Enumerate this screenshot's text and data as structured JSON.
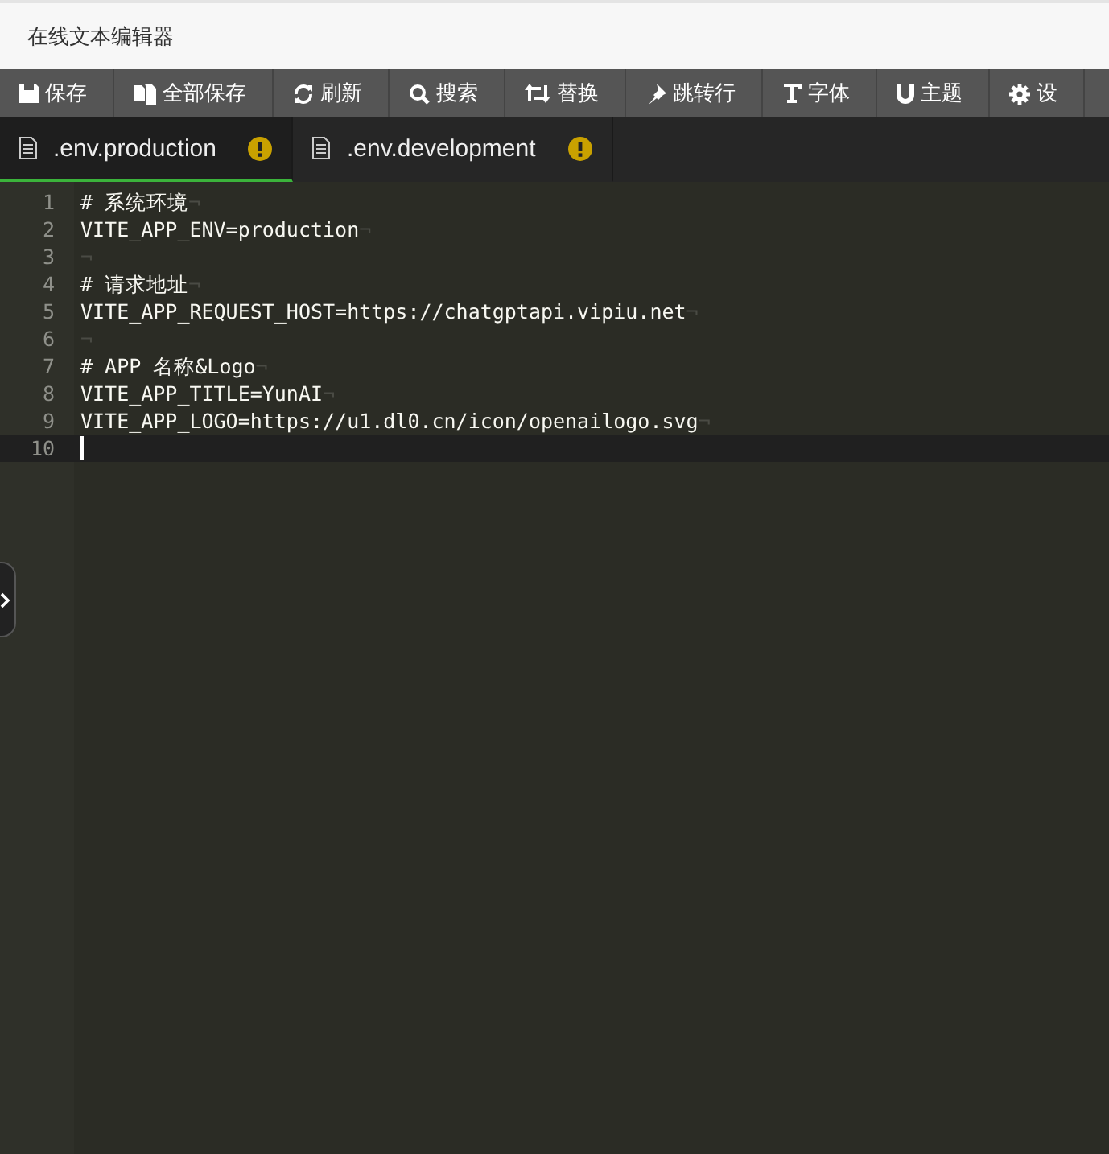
{
  "window": {
    "title": "在线文本编辑器"
  },
  "toolbar": [
    {
      "kind": "save",
      "label": "保存"
    },
    {
      "kind": "save-all",
      "label": "全部保存"
    },
    {
      "kind": "refresh",
      "label": "刷新"
    },
    {
      "kind": "search",
      "label": "搜索"
    },
    {
      "kind": "replace",
      "label": "替换"
    },
    {
      "kind": "goto",
      "label": "跳转行"
    },
    {
      "kind": "font",
      "label": "字体"
    },
    {
      "kind": "theme",
      "label": "主题"
    },
    {
      "kind": "settings",
      "label": "设"
    }
  ],
  "tabs": [
    {
      "label": ".env.production",
      "selected": true,
      "warning": true
    },
    {
      "label": ".env.development",
      "selected": false,
      "warning": true
    }
  ],
  "editor": {
    "lines": [
      {
        "number": "1",
        "text": "# 系统环境",
        "eol": "¬",
        "active": false
      },
      {
        "number": "2",
        "text": "VITE_APP_ENV=production",
        "eol": "¬",
        "active": false
      },
      {
        "number": "3",
        "eol": "¬",
        "active": false
      },
      {
        "number": "4",
        "text": "# 请求地址",
        "eol": "¬",
        "active": false
      },
      {
        "number": "5",
        "text": "VITE_APP_REQUEST_HOST=https://chatgptapi.vipiu.net",
        "eol": "¬",
        "active": false
      },
      {
        "number": "6",
        "eol": "¬",
        "active": false
      },
      {
        "number": "7",
        "text": "# APP 名称&Logo",
        "eol": "¬",
        "active": false
      },
      {
        "number": "8",
        "text": "VITE_APP_TITLE=YunAI",
        "eol": "¬",
        "active": false
      },
      {
        "number": "9",
        "text": "VITE_APP_LOGO=https://u1.dl0.cn/icon/openailogo.svg",
        "eol": "¬",
        "active": false
      },
      {
        "number": "10",
        "active": true
      }
    ]
  }
}
